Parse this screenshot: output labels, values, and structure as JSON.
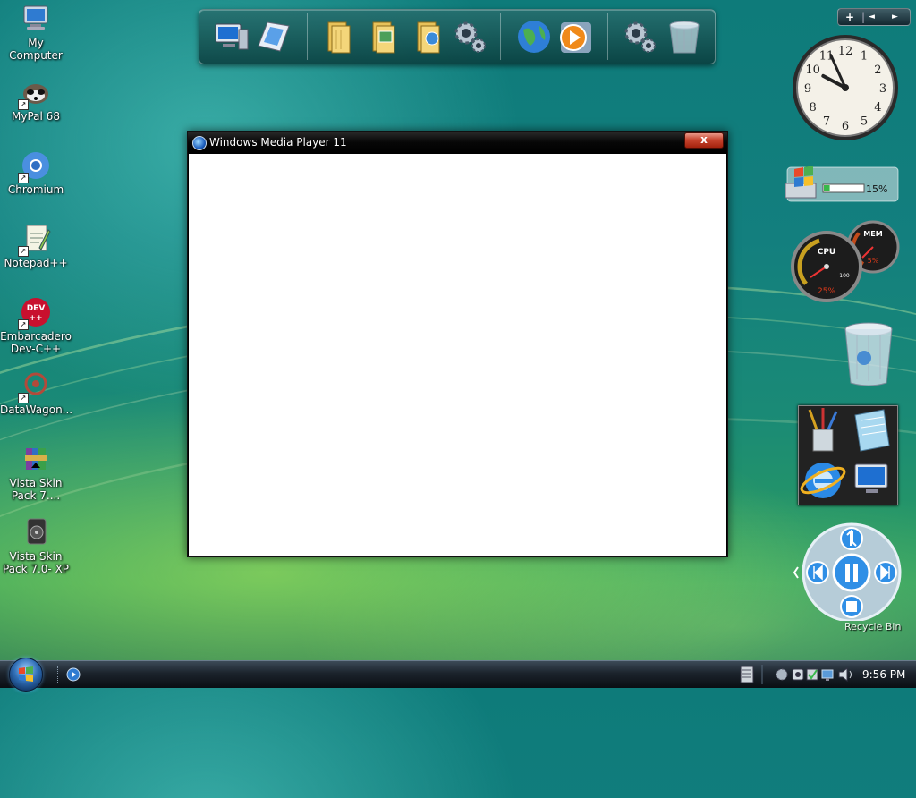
{
  "desktop": {
    "icons": [
      {
        "label": "My Computer",
        "icon": "computer-icon"
      },
      {
        "label": "MyPal 68",
        "icon": "raccoon-browser-icon"
      },
      {
        "label": "Chromium",
        "icon": "chromium-icon"
      },
      {
        "label": "Notepad++",
        "icon": "notepad-plus-plus-icon"
      },
      {
        "label": "Embarcadero Dev-C++",
        "icon": "dev-cpp-icon",
        "badge": "DEV"
      },
      {
        "label": "DataWagon...",
        "icon": "datawagon-icon"
      },
      {
        "label": "Vista Skin Pack 7....",
        "icon": "winrar-archive-icon"
      },
      {
        "label": "Vista Skin Pack 7.0- XP",
        "icon": "skin-pack-icon"
      }
    ]
  },
  "dock": {
    "items": [
      "my-computer-icon",
      "control-panel-icon",
      "documents-folder-icon",
      "pictures-folder-icon",
      "music-folder-icon",
      "settings-gears-icon",
      "internet-globe-icon",
      "media-player-icon",
      "system-gears-icon",
      "recycle-bin-icon"
    ]
  },
  "window": {
    "title": "Windows Media Player 11",
    "close_label": "x"
  },
  "gadgets": {
    "gadget_bar": {
      "add": "+",
      "prev": "◄",
      "next": "►"
    },
    "clock": {
      "hour": 9,
      "minute": 56,
      "numbers": [
        "12",
        "1",
        "2",
        "3",
        "4",
        "5",
        "6",
        "7",
        "8",
        "9",
        "10",
        "11"
      ]
    },
    "cpu_meter": {
      "percent_label": "15%",
      "fill": 0.15
    },
    "gauges": {
      "cpu_label": "CPU",
      "cpu_value": "25%",
      "cpu_max": "100",
      "mem_label": "MEM",
      "mem_value": "5%"
    },
    "media_control": {
      "label": "Recycle Bin"
    }
  },
  "taskbar": {
    "clock": "9:56 PM",
    "tray_icons": [
      "keyboard-icon",
      "settings-icon",
      "camera-icon",
      "security-check-icon",
      "network-icon",
      "volume-icon"
    ]
  },
  "colors": {
    "accent": "#0f7c7b",
    "taskbar": "#101820",
    "close": "#c8452f"
  }
}
